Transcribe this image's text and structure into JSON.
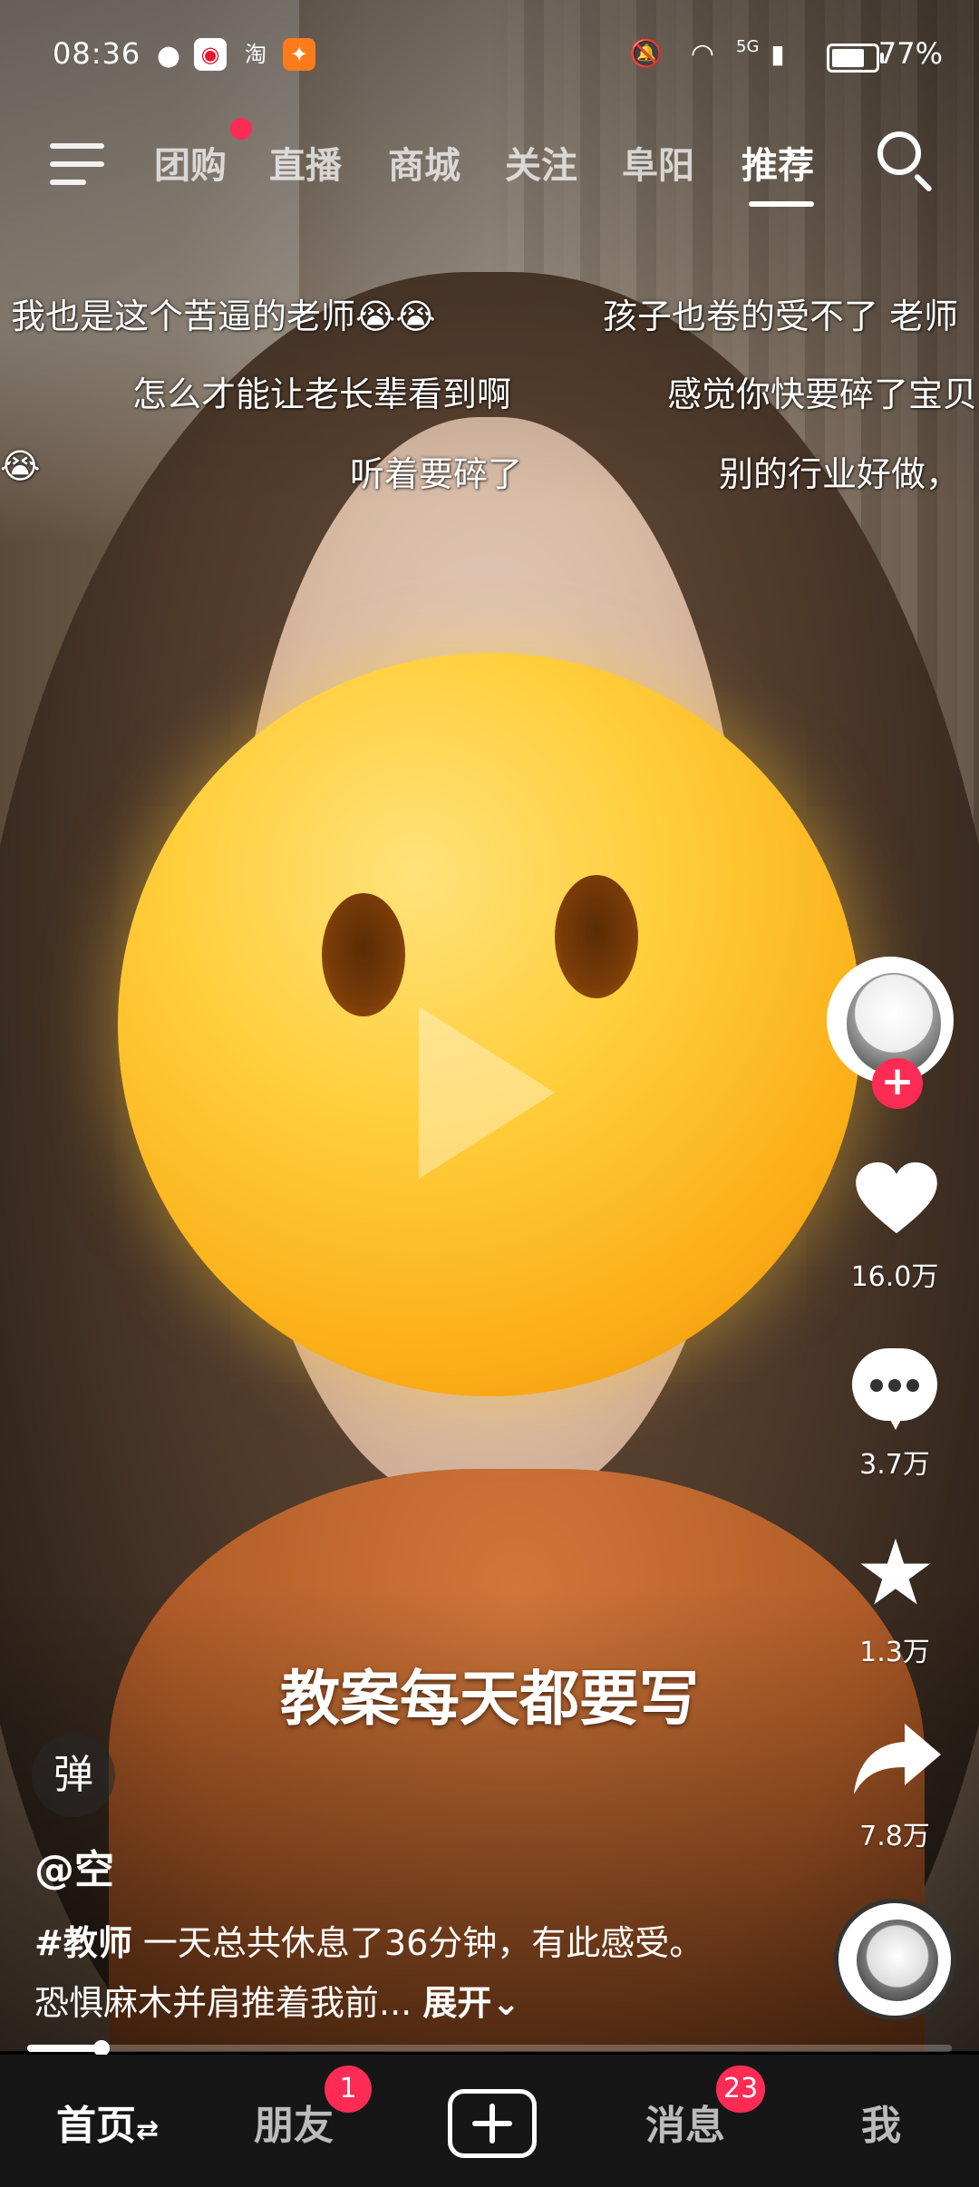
{
  "status_bar": {
    "time": "08:36",
    "app_icons": [
      "wechat-icon",
      "weibo-icon",
      "淘",
      "app-icon"
    ],
    "network": "5G",
    "battery_pct": "77%",
    "battery_level": 0.77
  },
  "top_nav": {
    "tabs": [
      "团购",
      "直播",
      "商城",
      "关注",
      "阜阳",
      "推荐"
    ],
    "active_tab": "推荐"
  },
  "danmu": [
    {
      "text": "我也是这个苦逼的老师😭😭"
    },
    {
      "text": "孩子也卷的受不了 老师"
    },
    {
      "text": "怎么才能让老长辈看到啊"
    },
    {
      "text": "感觉你快要碎了宝贝"
    },
    {
      "text": "😭"
    },
    {
      "text": "听着要碎了"
    },
    {
      "text": "别的行业好做，"
    }
  ],
  "actions": {
    "likes": "16.0万",
    "comments": "3.7万",
    "favorites": "1.3万",
    "shares": "7.8万"
  },
  "caption": "教案每天都要写",
  "danmu_toggle": "弹",
  "author": "@空",
  "description": {
    "tag": "#教师",
    "text": " 一天总共休息了36分钟，有此感受。 恐惧麻木并肩推着我前...",
    "expand": "展开⌄"
  },
  "progress": 0.08,
  "bottom_nav": {
    "items": [
      "首页",
      "朋友",
      "消息",
      "我"
    ],
    "home_suffix": "⇄",
    "friends_badge": "1",
    "messages_badge": "23"
  }
}
